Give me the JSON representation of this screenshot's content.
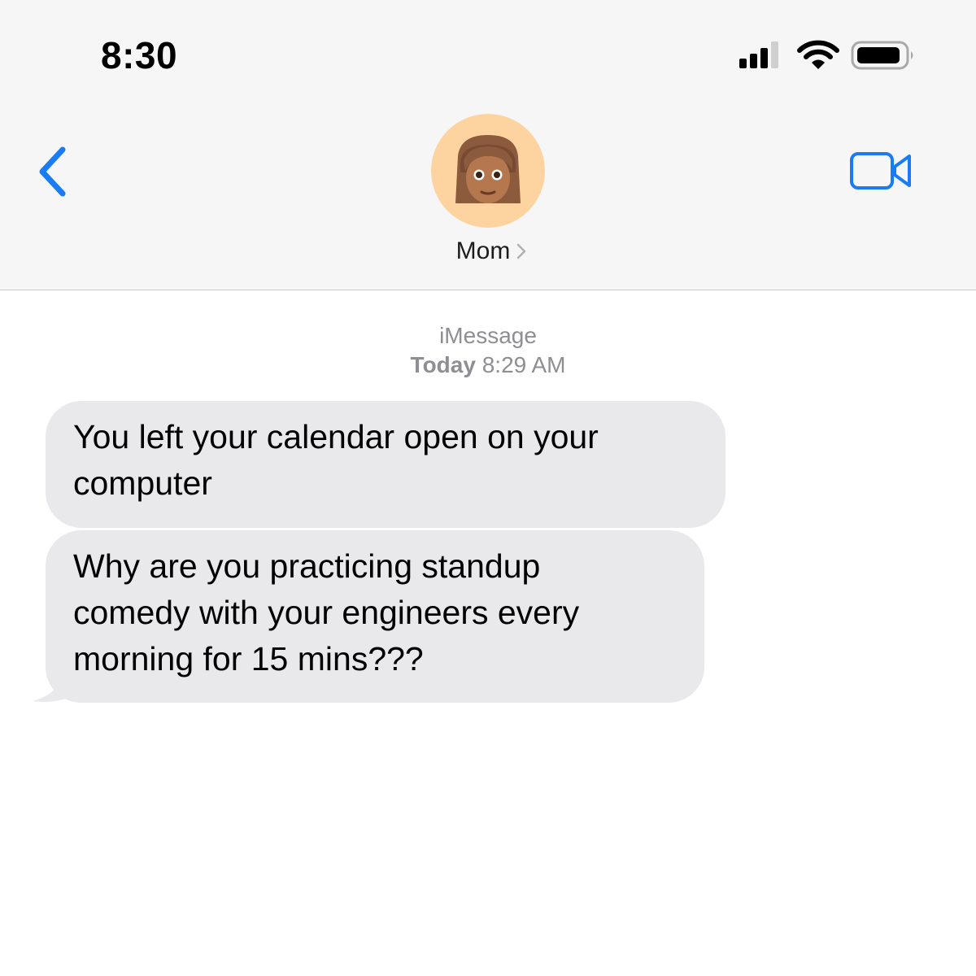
{
  "status_bar": {
    "time": "8:30",
    "icons": [
      "cellular-signal-icon",
      "wifi-icon",
      "battery-icon"
    ]
  },
  "header": {
    "back_icon": "chevron-left-icon",
    "contact": {
      "name": "Mom",
      "avatar": "woman-emoji-avatar"
    },
    "video_icon": "video-camera-icon"
  },
  "conversation": {
    "service": "iMessage",
    "timestamp_day": "Today",
    "timestamp_time": "8:29 AM",
    "messages": [
      {
        "direction": "incoming",
        "lines": [
          "You left your calendar open on your",
          "computer"
        ]
      },
      {
        "direction": "incoming",
        "lines": [
          "Why are you practicing standup",
          "comedy with your engineers every",
          "morning for 15 mins???"
        ]
      }
    ]
  },
  "colors": {
    "accent": "#1a7cf5",
    "header_bg": "#f6f6f6",
    "incoming_bubble": "#e9e9eb",
    "avatar_bg": "#fdd4a0",
    "secondary_text": "#8e8e93"
  }
}
